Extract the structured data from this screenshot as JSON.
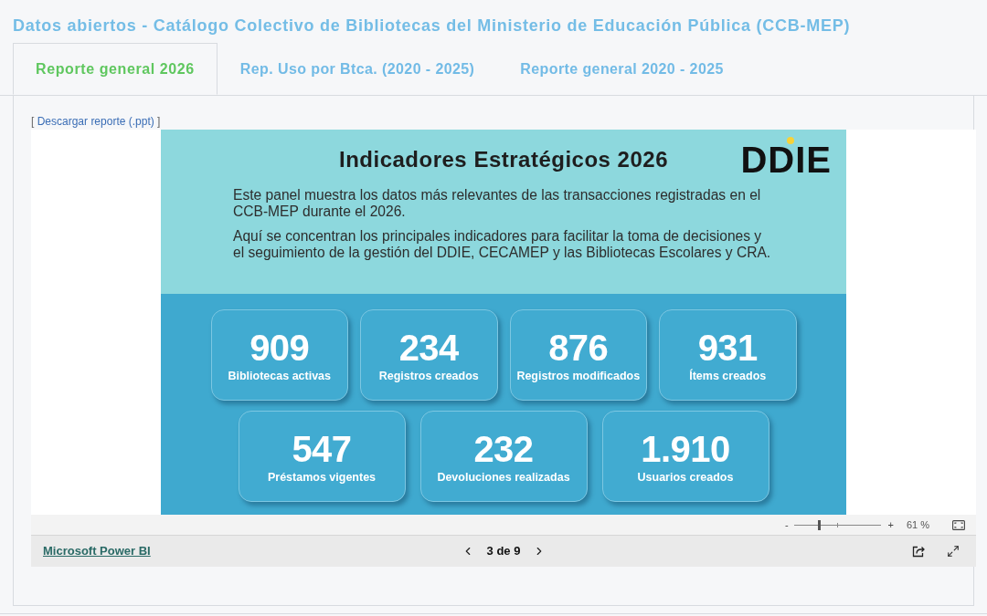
{
  "page_title": "Datos abiertos - Catálogo Colectivo de Bibliotecas del Ministerio de Educación Pública (CCB-MEP)",
  "tabs": [
    {
      "label": "Reporte general 2026",
      "selected": true
    },
    {
      "label": "Rep. Uso por Btca. (2020 - 2025)",
      "selected": false
    },
    {
      "label": "Reporte general 2020 - 2025",
      "selected": false
    }
  ],
  "download": {
    "prefix": "[",
    "link": "Descargar reporte (.ppt)",
    "suffix": "]"
  },
  "report": {
    "logo": "DDIE",
    "title": "Indicadores Estratégicos 2026",
    "paragraphs": [
      "Este panel muestra los datos más relevantes de las transacciones registradas en el CCB-MEP durante el 2026.",
      "Aquí se concentran los principales indicadores para facilitar la toma de decisiones y el seguimiento de la gestión del DDIE, CECAMEP y las Bibliotecas Escolares y CRA."
    ],
    "kpi_rows": [
      {
        "cards": [
          {
            "value": "909",
            "label": "Bibliotecas activas"
          },
          {
            "value": "234",
            "label": "Registros creados"
          },
          {
            "value": "876",
            "label": "Registros modificados"
          },
          {
            "value": "931",
            "label": "Ítems creados"
          }
        ]
      },
      {
        "cards": [
          {
            "value": "547",
            "label": "Préstamos vigentes"
          },
          {
            "value": "232",
            "label": "Devoluciones realizadas"
          },
          {
            "value": "1.910",
            "label": "Usuarios creados"
          }
        ]
      }
    ]
  },
  "zoom": {
    "minus": "-",
    "plus": "+",
    "level": 0.29,
    "reading": "61 %"
  },
  "footer": {
    "brand_link": "Microsoft Power BI",
    "page_indicator": "3 de 9"
  }
}
